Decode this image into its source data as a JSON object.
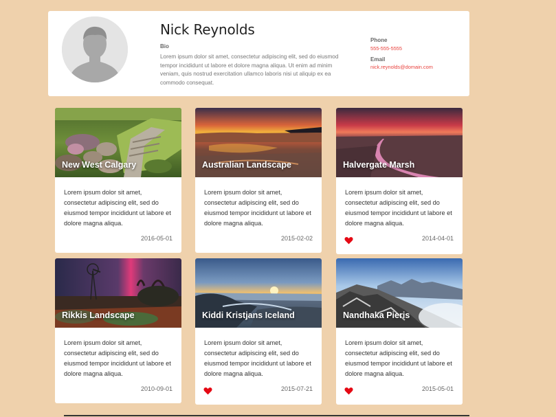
{
  "profile": {
    "name": "Nick Reynolds",
    "bio_label": "Bio",
    "bio_text": "Lorem ipsum dolor sit amet, consectetur adipiscing elit, sed do eiusmod tempor incididunt ut labore et dolore magna aliqua. Ut enim ad minim veniam, quis nostrud exercitation ullamco laboris nisi ut aliquip ex ea commodo consequat.",
    "phone_label": "Phone",
    "phone": "555-555-5555",
    "email_label": "Email",
    "email": "nick.reynolds@domain.com"
  },
  "accent_color": "#e8413c",
  "cards": [
    {
      "title": "New West Calgary",
      "text": "Lorem ipsum dolor sit amet, consectetur adipiscing elit, sed do eiusmod tempor incididunt ut labore et dolore magna aliqua.",
      "date": "2016-05-01",
      "liked": false
    },
    {
      "title": "Australian Landscape",
      "text": "Lorem ipsum dolor sit amet, consectetur adipiscing elit, sed do eiusmod tempor incididunt ut labore et dolore magna aliqua.",
      "date": "2015-02-02",
      "liked": false
    },
    {
      "title": "Halvergate Marsh",
      "text": "Lorem ipsum dolor sit amet, consectetur adipiscing elit, sed do eiusmod tempor incididunt ut labore et dolore magna aliqua.",
      "date": "2014-04-01",
      "liked": true
    },
    {
      "title": "Rikkis Landscape",
      "text": "Lorem ipsum dolor sit amet, consectetur adipiscing elit, sed do eiusmod tempor incididunt ut labore et dolore magna aliqua.",
      "date": "2010-09-01",
      "liked": false
    },
    {
      "title": "Kiddi Kristjans Iceland",
      "text": "Lorem ipsum dolor sit amet, consectetur adipiscing elit, sed do eiusmod tempor incididunt ut labore et dolore magna aliqua.",
      "date": "2015-07-21",
      "liked": true
    },
    {
      "title": "Nandhaka Pieris",
      "text": "Lorem ipsum dolor sit amet, consectetur adipiscing elit, sed do eiusmod tempor incididunt ut labore et dolore magna aliqua.",
      "date": "2015-05-01",
      "liked": true
    }
  ]
}
